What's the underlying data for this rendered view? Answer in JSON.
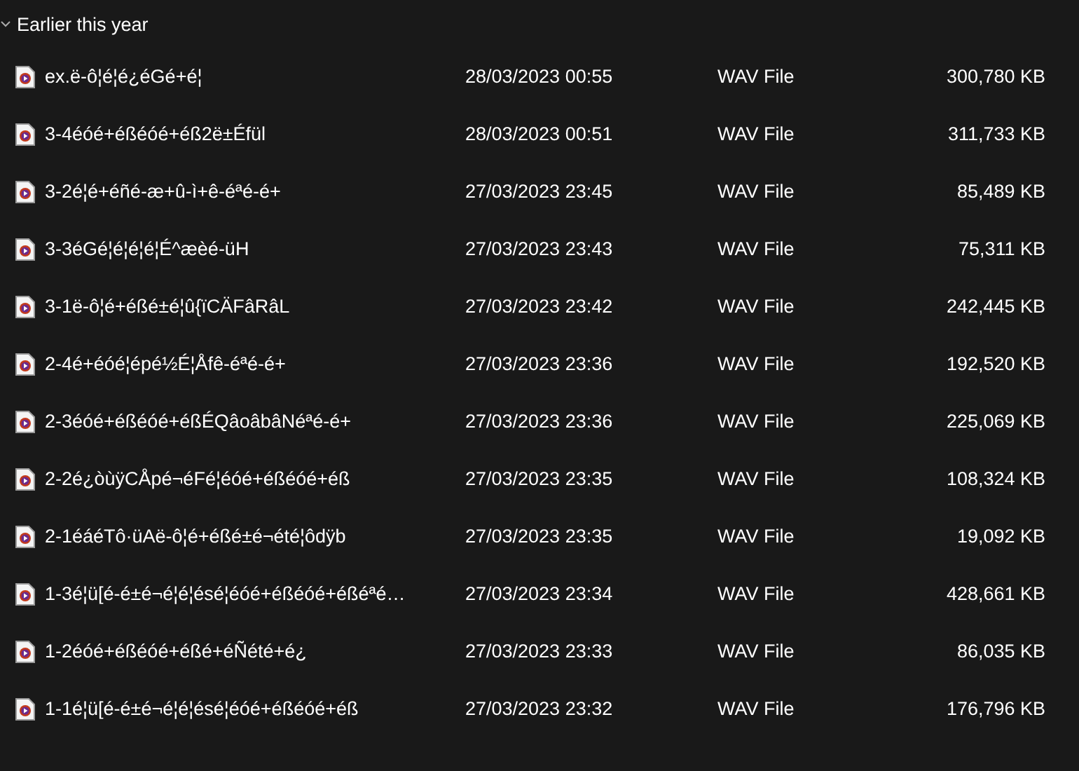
{
  "group": {
    "title": "Earlier this year",
    "expanded": true
  },
  "files": [
    {
      "name": "ex.ë-ô¦é¦é¿éGé+é¦",
      "date": "28/03/2023 00:55",
      "type": "WAV File",
      "size": "300,780 KB"
    },
    {
      "name": "3-4éóé+éßéóé+éß2ë±Éfül",
      "date": "28/03/2023 00:51",
      "type": "WAV File",
      "size": "311,733 KB"
    },
    {
      "name": "3-2é¦é+éñé-æ+û-ì+ê-éªé-é+",
      "date": "27/03/2023 23:45",
      "type": "WAV File",
      "size": "85,489 KB"
    },
    {
      "name": "3-3éGé¦é¦é¦é¦É^æèé-üH",
      "date": "27/03/2023 23:43",
      "type": "WAV File",
      "size": "75,311 KB"
    },
    {
      "name": "3-1ë-ô¦é+éßé±é¦û{ïCÄFâRâL",
      "date": "27/03/2023 23:42",
      "type": "WAV File",
      "size": "242,445 KB"
    },
    {
      "name": "2-4é+éóé¦épé½É¦Åfê-éªé-é+",
      "date": "27/03/2023 23:36",
      "type": "WAV File",
      "size": "192,520 KB"
    },
    {
      "name": "2-3éóé+éßéóé+éßÉQâoâbâNéªé-é+",
      "date": "27/03/2023 23:36",
      "type": "WAV File",
      "size": "225,069 KB"
    },
    {
      "name": "2-2é¿òùÿCÅpé¬éFé¦éóé+éßéóé+éß",
      "date": "27/03/2023 23:35",
      "type": "WAV File",
      "size": "108,324 KB"
    },
    {
      "name": "2-1éáéTô·üAë-ô¦é+éßé±é¬été¦ôdÿb",
      "date": "27/03/2023 23:35",
      "type": "WAV File",
      "size": "19,092 KB"
    },
    {
      "name": "1-3é¦ü[é-é±é¬é¦é¦ésé¦éóé+éßéóé+éßéªé…",
      "date": "27/03/2023 23:34",
      "type": "WAV File",
      "size": "428,661 KB"
    },
    {
      "name": "1-2éóé+éßéóé+éßé+éÑété+é¿",
      "date": "27/03/2023 23:33",
      "type": "WAV File",
      "size": "86,035 KB"
    },
    {
      "name": "1-1é¦ü[é-é±é¬é¦é¦ésé¦éóé+éßéóé+éß",
      "date": "27/03/2023 23:32",
      "type": "WAV File",
      "size": "176,796 KB"
    }
  ]
}
